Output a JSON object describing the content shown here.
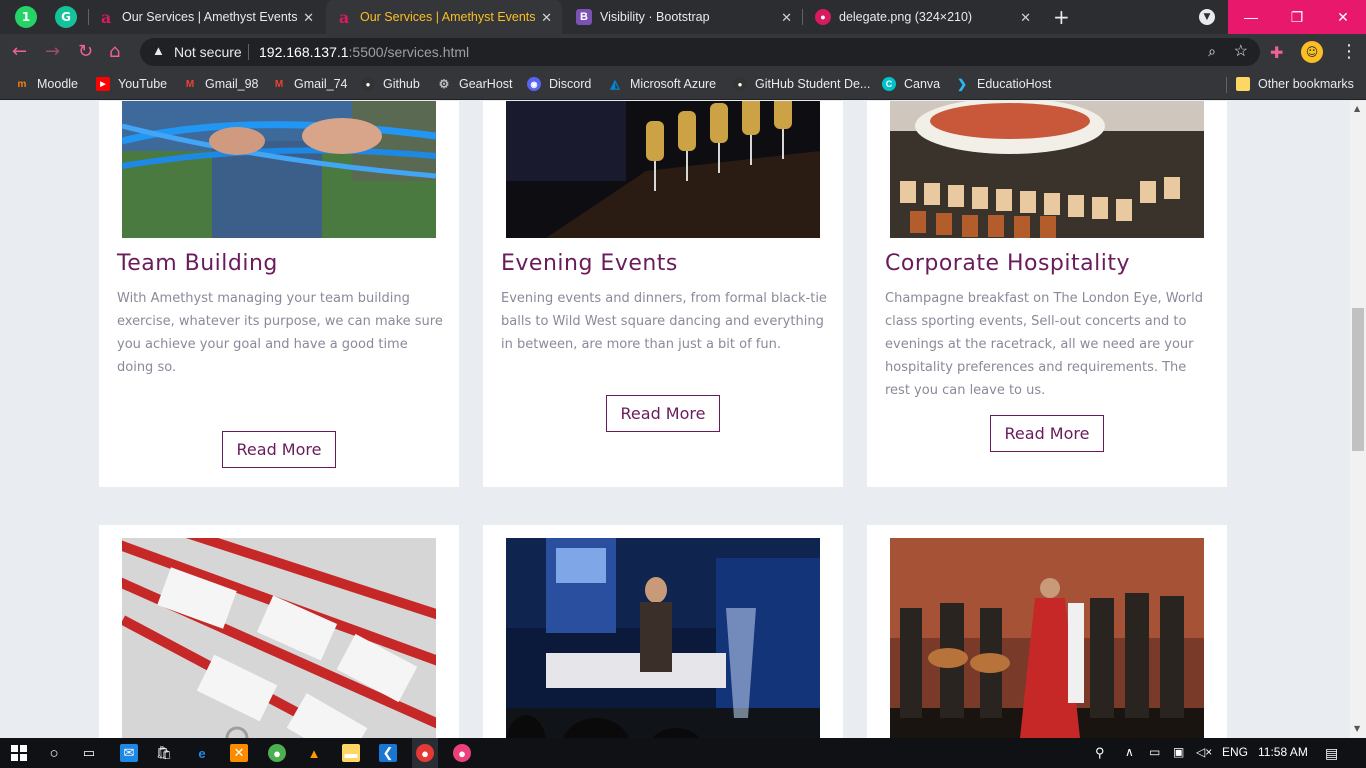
{
  "browser": {
    "tabs": [
      {
        "title": "Our Services | Amethyst Events",
        "active": false
      },
      {
        "title": "Our Services | Amethyst Events",
        "active": true
      },
      {
        "title": "Visibility · Bootstrap",
        "active": false
      },
      {
        "title": "delegate.png (324×210)",
        "active": false
      }
    ],
    "omnibox": {
      "security": "Not secure",
      "host": "192.168.137.1",
      "path": ":5500/services.html"
    },
    "bookmarks": [
      {
        "label": "Moodle",
        "icon": "moodle-icon",
        "color": "#f98012"
      },
      {
        "label": "YouTube",
        "icon": "youtube-icon",
        "color": "#ff0000"
      },
      {
        "label": "Gmail_98",
        "icon": "gmail-icon",
        "color": "#ea4335"
      },
      {
        "label": "Gmail_74",
        "icon": "gmail-icon",
        "color": "#ea4335"
      },
      {
        "label": "Github",
        "icon": "github-icon",
        "color": "#333333"
      },
      {
        "label": "GearHost",
        "icon": "gearhost-icon",
        "color": "#9e9e9e"
      },
      {
        "label": "Discord",
        "icon": "discord-icon",
        "color": "#5865f2"
      },
      {
        "label": "Microsoft Azure",
        "icon": "azure-icon",
        "color": "#0089d6"
      },
      {
        "label": "GitHub Student De...",
        "icon": "github-icon",
        "color": "#333333"
      },
      {
        "label": "Canva",
        "icon": "canva-icon",
        "color": "#00c4cc"
      },
      {
        "label": "EducatioHost",
        "icon": "educatiohost-icon",
        "color": "#29b6f6"
      }
    ],
    "other_bookmarks": "Other bookmarks"
  },
  "services": [
    {
      "title": "Team Building",
      "description": "With Amethyst managing your team building exercise, whatever its purpose, we can make sure you achieve your goal and have a good time doing so.",
      "button": "Read More"
    },
    {
      "title": "Evening Events",
      "description": "Evening events and dinners, from formal black-tie balls to Wild West square dancing and everything in between, are more than just a bit of fun.",
      "button": "Read More"
    },
    {
      "title": "Corporate Hospitality",
      "description": "Champagne breakfast on The London Eye, World class sporting events, Sell-out concerts and to evenings at the racetrack, all we need are your hospitality preferences and requirements. The rest you can leave to us.",
      "button": "Read More"
    }
  ],
  "taskbar": {
    "language": "ENG",
    "time": "11:58 AM"
  },
  "colors": {
    "accent": "#6a1b5b",
    "body_text": "#8a8a9a",
    "page_bg": "#e9edf2",
    "chrome_pink": "#e8186d"
  }
}
